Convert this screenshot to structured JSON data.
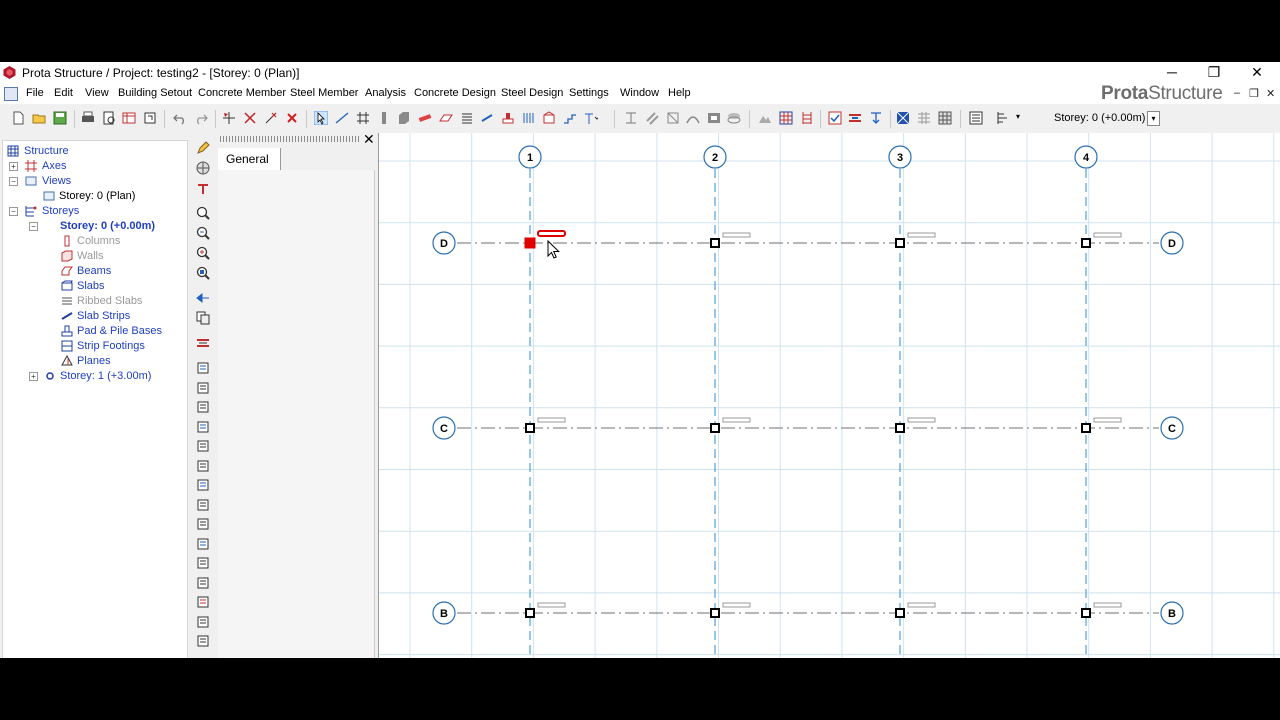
{
  "window": {
    "title": "Prota Structure / Project: testing2 - [Storey: 0 (Plan)]",
    "controls": {
      "minimize": "─",
      "restore": "❐",
      "close": "✕"
    }
  },
  "menu": {
    "items": [
      "File",
      "Edit",
      "View",
      "Building Setout",
      "Concrete Member",
      "Steel Member",
      "Analysis",
      "Concrete Design",
      "Steel Design",
      "Settings",
      "Window",
      "Help"
    ],
    "brand_bold": "Prota",
    "brand_rest": "Structure",
    "mdi_controls": {
      "minimize": "‒",
      "restore": "❐",
      "close": "✕"
    }
  },
  "toolbar": {
    "storey_selected": "Storey: 0 (+0.00m)",
    "dropdown_glyph": "▾"
  },
  "tree": {
    "root": "Structure",
    "axes": "Axes",
    "views": "Views",
    "view_plan": "Storey: 0 (Plan)",
    "storeys": "Storeys",
    "storey0": "Storey: 0 (+0.00m)",
    "storey0_children": [
      "Columns",
      "Walls",
      "Beams",
      "Slabs",
      "Ribbed Slabs",
      "Slab Strips",
      "Pad & Pile Bases",
      "Strip Footings",
      "Planes"
    ],
    "storey1": "Storey: 1 (+3.00m)",
    "expand_glyph": "+",
    "collapse_glyph": "−"
  },
  "side_panel": {
    "tab": "General",
    "close_glyph": "✕"
  },
  "plan": {
    "vertical_axes": [
      "1",
      "2",
      "3",
      "4"
    ],
    "horizontal_axes": [
      "D",
      "C",
      "B"
    ],
    "colors": {
      "grid": "#cfe3ef",
      "axis_vertical": "#2e8fd0",
      "axis_horizontal": "#707070",
      "selected": "#e00000"
    },
    "selected_column": {
      "axis_x": "1",
      "axis_y": "D"
    }
  }
}
